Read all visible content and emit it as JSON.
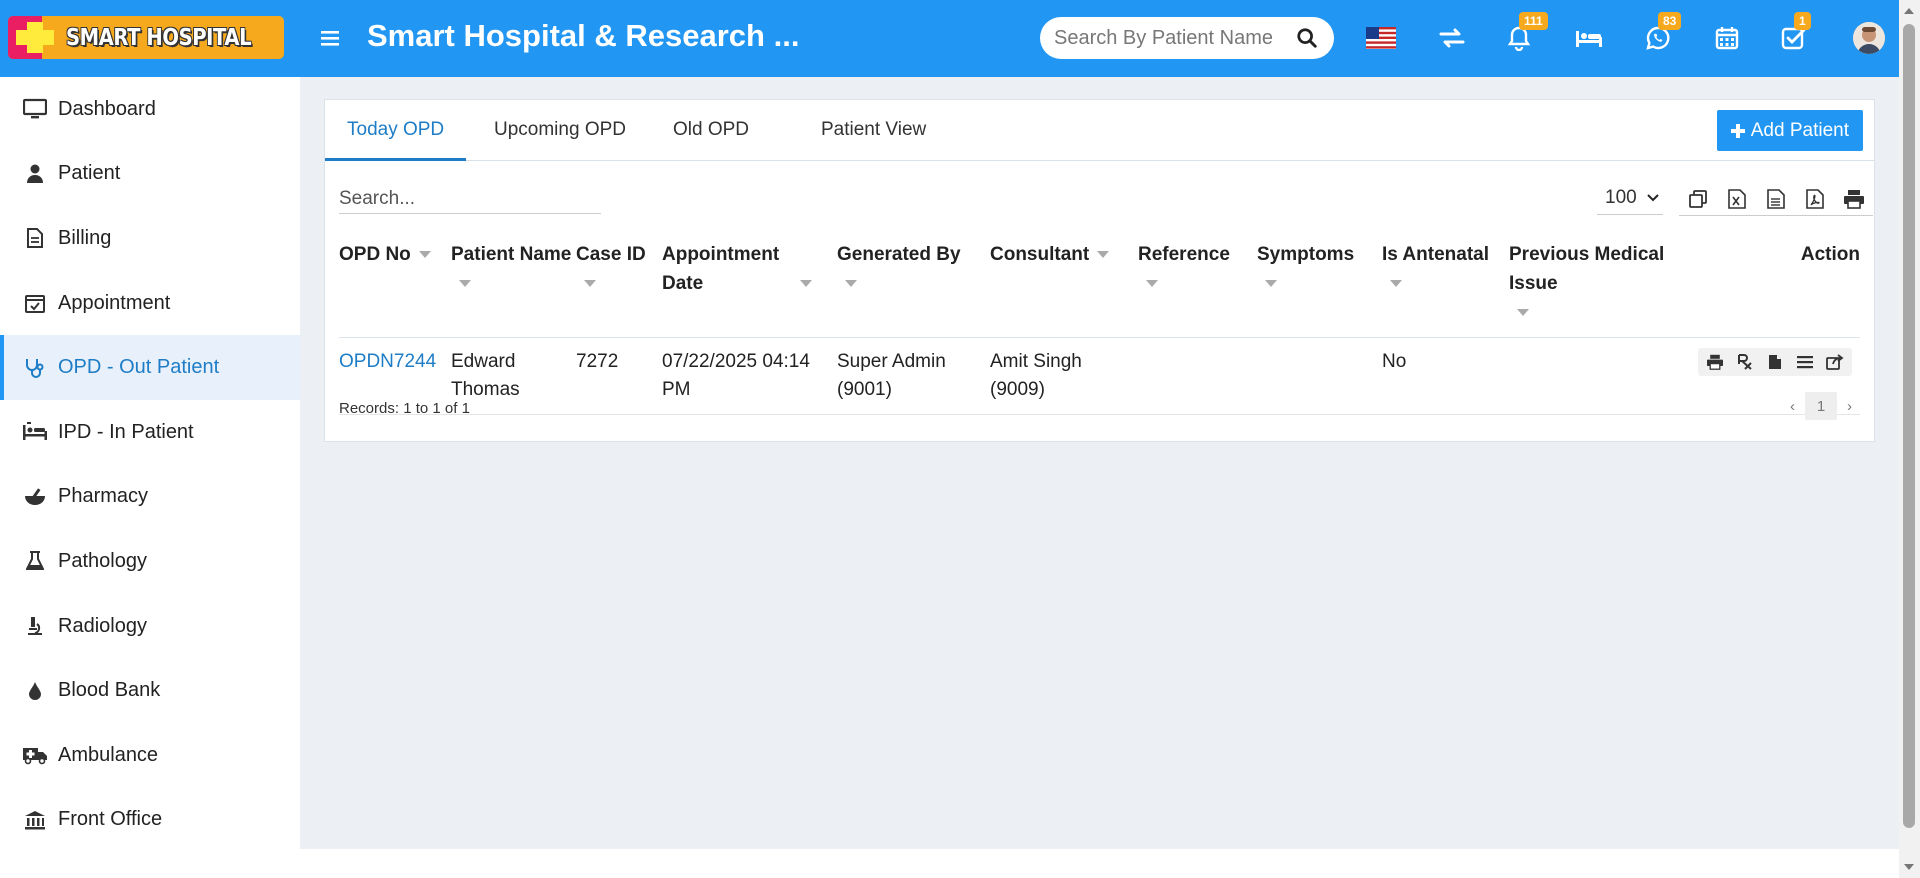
{
  "header": {
    "logo_text": "SMART HOSPITAL",
    "title": "Smart Hospital & Research ...",
    "search_placeholder": "Search By Patient Name",
    "badges": {
      "notifications": "111",
      "whatsapp": "83",
      "tasks": "1"
    },
    "brand_color": "#2196f3",
    "badge_color": "#f7a91e"
  },
  "sidebar": {
    "items": [
      {
        "label": "Dashboard",
        "icon": "monitor-icon"
      },
      {
        "label": "Patient",
        "icon": "user-icon"
      },
      {
        "label": "Billing",
        "icon": "file-icon"
      },
      {
        "label": "Appointment",
        "icon": "calendar-check-icon"
      },
      {
        "label": "OPD - Out Patient",
        "icon": "stethoscope-icon",
        "active": true
      },
      {
        "label": "IPD - In Patient",
        "icon": "hospital-bed-icon"
      },
      {
        "label": "Pharmacy",
        "icon": "mortar-pestle-icon"
      },
      {
        "label": "Pathology",
        "icon": "flask-icon"
      },
      {
        "label": "Radiology",
        "icon": "microscope-icon"
      },
      {
        "label": "Blood Bank",
        "icon": "drop-icon"
      },
      {
        "label": "Ambulance",
        "icon": "ambulance-icon"
      },
      {
        "label": "Front Office",
        "icon": "building-icon"
      }
    ]
  },
  "tabs": [
    {
      "label": "Today OPD",
      "active": true
    },
    {
      "label": "Upcoming OPD"
    },
    {
      "label": "Old OPD"
    },
    {
      "label": "Patient View"
    }
  ],
  "add_button": "Add Patient",
  "table": {
    "search_placeholder": "Search...",
    "page_size": "100",
    "columns": [
      "OPD No",
      "Patient Name",
      "Case ID",
      "Appointment Date",
      "Generated By",
      "Consultant",
      "Reference",
      "Symptoms",
      "Is Antenatal",
      "Previous Medical Issue",
      "Action"
    ],
    "rows": [
      {
        "opd_no": "OPDN7244",
        "patient_name": "Edward Thomas",
        "case_id": "7272",
        "appointment_date": "07/22/2025 04:14 PM",
        "generated_by": "Super Admin (9001)",
        "consultant": "Amit Singh (9009)",
        "reference": "",
        "symptoms": "",
        "is_antenatal": "No",
        "previous_medical_issue": ""
      }
    ],
    "records_text": "Records: 1 to 1 of 1",
    "current_page": "1"
  }
}
